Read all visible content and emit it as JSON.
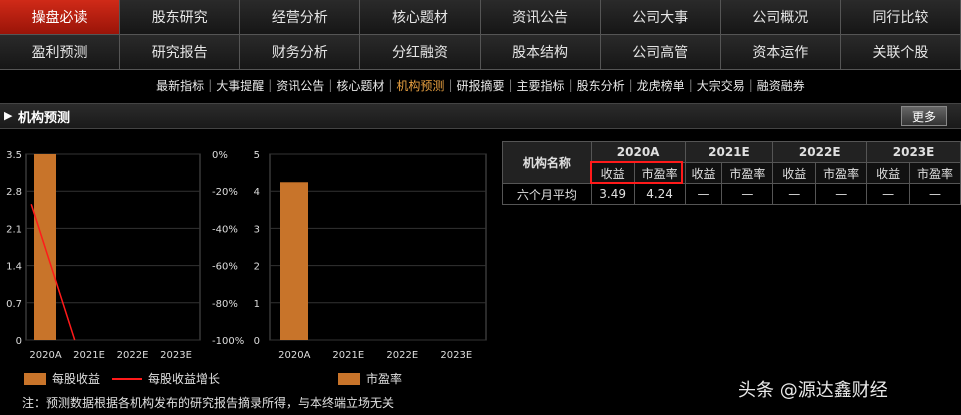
{
  "tabs_row1": [
    "操盘必读",
    "股东研究",
    "经营分析",
    "核心题材",
    "资讯公告",
    "公司大事",
    "公司概况",
    "同行比较"
  ],
  "tabs_row2": [
    "盈利预测",
    "研究报告",
    "财务分析",
    "分红融资",
    "股本结构",
    "公司高管",
    "资本运作",
    "关联个股"
  ],
  "subnav": [
    "最新指标",
    "大事提醒",
    "资讯公告",
    "核心题材",
    "机构预测",
    "研报摘要",
    "主要指标",
    "股东分析",
    "龙虎榜单",
    "大宗交易",
    "融资融券"
  ],
  "section": {
    "title": "机构预测",
    "more": "更多"
  },
  "colors": {
    "bar": "#c8742a",
    "growth_line": "#ff1a1a",
    "active_tab": "#c8200f"
  },
  "chart_data": [
    {
      "type": "bar",
      "categories": [
        "2020A",
        "2021E",
        "2022E",
        "2023E"
      ],
      "series": [
        {
          "name": "每股收益",
          "values": [
            3.5,
            null,
            null,
            null
          ]
        },
        {
          "name": "每股收益增长",
          "axis": "right",
          "values": [
            -27,
            -100,
            null,
            null
          ]
        }
      ],
      "yticks_left": [
        "3.5",
        "2.8",
        "2.1",
        "1.4",
        "0.7",
        "0"
      ],
      "yticks_right": [
        "0%",
        "-20%",
        "-40%",
        "-60%",
        "-80%",
        "-100%"
      ],
      "ylim": [
        0,
        3.5
      ],
      "ylim_right": [
        -100,
        0
      ]
    },
    {
      "type": "bar",
      "categories": [
        "2020A",
        "2021E",
        "2022E",
        "2023E"
      ],
      "series": [
        {
          "name": "市盈率",
          "values": [
            4.24,
            null,
            null,
            null
          ]
        }
      ],
      "yticks_left": [
        "5",
        "4",
        "3",
        "2",
        "1",
        "0"
      ],
      "ylim": [
        0,
        5
      ]
    }
  ],
  "table": {
    "corner": "机构名称",
    "years": [
      "2020A",
      "2021E",
      "2022E",
      "2023E"
    ],
    "subheads": [
      "收益",
      "市盈率"
    ],
    "rows": [
      {
        "name": "六个月平均",
        "values": [
          "3.49",
          "4.24",
          "—",
          "—",
          "—",
          "—",
          "—",
          "—"
        ]
      }
    ]
  },
  "legend": {
    "eps": "每股收益",
    "growth": "每股收益增长",
    "pe": "市盈率"
  },
  "note": "注：预测数据根据各机构发布的研究报告摘录所得，与本终端立场无关",
  "watermark": "头条 @源达鑫财经"
}
